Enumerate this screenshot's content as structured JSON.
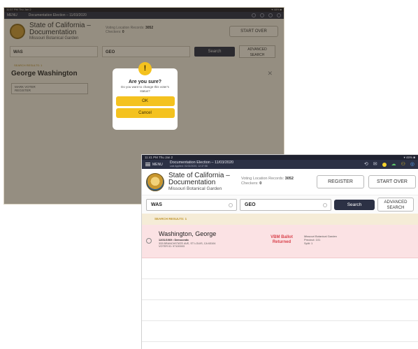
{
  "back_screen": {
    "status_left": "11:57 PM  Thu Jan 2",
    "status_right": "▾ 48% ■",
    "menu_label": "MENU",
    "election": "Documentation Election – 11/03/2020",
    "org_title_1": "State of California –",
    "org_title_2": "Documentation",
    "org_sub": "Missouri Botanical Garden",
    "voting_records_label": "Voting Location Records:",
    "voting_records_value": "3052",
    "checkins_label": "Checkers:",
    "checkins_value": "0",
    "start_over": "START OVER",
    "last_name": "WAS",
    "first_name": "GEO",
    "search": "Search",
    "advanced_1": "ADVANCED",
    "advanced_2": "SEARCH",
    "results": "SEARCH RESULTS: 1",
    "voter_name": "George  Washington",
    "close": "✕",
    "mark_1": "MARK VOTER",
    "mark_2": "REGISTER",
    "mark_chevron": "⌄",
    "dialog": {
      "icon": "!",
      "title": "Are you sure?",
      "message": "Do you want to change this voter's status?",
      "ok": "OK",
      "cancel": "Cancel"
    }
  },
  "front_screen": {
    "status_left": "11:41 PM  Thu Jan 2",
    "status_right": "▾ 46% ■",
    "menu_label": "MENU",
    "election": "Documentation Election – 11/03/2020",
    "last_synced": "Last Applied: 01/02/2020, 12:37:58",
    "org_title_1": "State of California –",
    "org_title_2": "Documentation",
    "org_sub": "Missouri Botanical Garden",
    "voting_records_label": "Voting Location Records:",
    "voting_records_value": "3052",
    "checkins_label": "Checkers:",
    "checkins_value": "0",
    "register": "REGISTER",
    "start_over": "START OVER",
    "last_name": "WAS",
    "first_name": "GEO",
    "search": "Search",
    "advanced_1": "ADVANCED",
    "advanced_2": "SEARCH",
    "results": "SEARCH RESULTS: 1",
    "voter": {
      "name": "Washington, George",
      "dob_party": "12/31/1969 • Democratic",
      "address": "333 BRANCHSTATE AVE, ST LOUIS, CA 63104",
      "voter_id": "VOTER ID: 97100003",
      "status_1": "VBM Ballot",
      "status_2": "Returned",
      "location": "Missouri Botanical Garden",
      "precinct": "Precinct: 101",
      "split": "Split: 1"
    }
  },
  "colors": {
    "navy": "#2c3145",
    "warning_yellow": "#f4c21f",
    "vbm_red": "#d9434d",
    "row_pink": "#fbe2e4"
  }
}
